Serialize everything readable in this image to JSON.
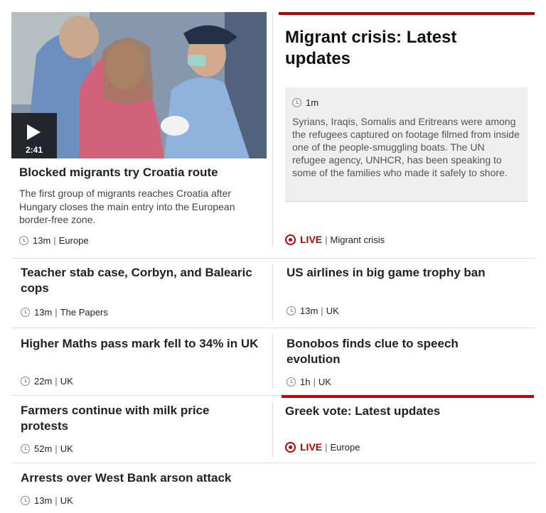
{
  "featured": {
    "video_duration": "2:41",
    "headline": "Blocked migrants try Croatia route",
    "summary": "The first group of migrants reaches Croatia after Hungary closes the main entry into the European border-free zone.",
    "time": "13m",
    "section": "Europe"
  },
  "live_main": {
    "headline": "Migrant crisis: Latest updates",
    "update_time": "1m",
    "update_text": "Syrians, Iraqis, Somalis and Eritreans were among the refugees captured on footage filmed from inside one of the people-smuggling boats. The UN refugee agency, UNHCR, has been speaking to some of the families who made it safely to shore.",
    "live_label": "LIVE",
    "section": "Migrant crisis"
  },
  "stories": [
    {
      "headline": "Teacher stab case, Corbyn, and Balearic cops",
      "time": "13m",
      "section": "The Papers"
    },
    {
      "headline": "US airlines in big game trophy ban",
      "time": "13m",
      "section": "UK"
    },
    {
      "headline": "Higher Maths pass mark fell to 34% in UK",
      "time": "22m",
      "section": "UK"
    },
    {
      "headline": "Bonobos finds clue to speech evolution",
      "time": "1h",
      "section": "UK"
    },
    {
      "headline": "Farmers continue with milk price protests",
      "time": "52m",
      "section": "UK"
    },
    {
      "headline": "Arrests over West Bank arson attack",
      "time": "13m",
      "section": "UK"
    }
  ],
  "live_greek": {
    "headline": "Greek vote: Latest updates",
    "live_label": "LIVE",
    "section": "Europe"
  },
  "colors": {
    "live_red": "#b80000",
    "divider": "#dcdcdc",
    "update_bg": "#efefef"
  },
  "icons": [
    "play-icon",
    "clock-icon",
    "live-icon"
  ]
}
